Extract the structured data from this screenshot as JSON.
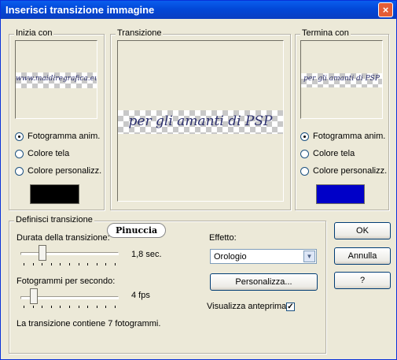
{
  "window": {
    "title": "Inserisci transizione immagine",
    "close": "×"
  },
  "start": {
    "group_label": "Inizia con",
    "preview_text": "www.maidiregrafica.eu",
    "options": [
      "Fotogramma anim.",
      "Colore tela",
      "Colore personalizz."
    ],
    "selected": 0,
    "swatch_color": "#000000"
  },
  "transition": {
    "group_label": "Transizione",
    "preview_text": "per gli amanti di PSP"
  },
  "end": {
    "group_label": "Termina con",
    "preview_text": "per gli amanti di PSP",
    "options": [
      "Fotogramma anim.",
      "Colore tela",
      "Colore personalizz."
    ],
    "selected": 0,
    "swatch_color": "#0000c8"
  },
  "define": {
    "group_label": "Definisci transizione",
    "badge": "Pinuccia",
    "duration_label": "Durata della transizione:",
    "duration_value": "1,8 sec.",
    "fps_label": "Fotogrammi per secondo:",
    "fps_value": "4 fps",
    "summary": "La transizione contiene 7 fotogrammi.",
    "effect_label": "Effetto:",
    "effect_value": "Orologio",
    "customize_button": "Personalizza...",
    "preview_label": "Visualizza anteprima",
    "preview_checked": true,
    "preview_check_glyph": "✓"
  },
  "buttons": {
    "ok": "OK",
    "cancel": "Annulla",
    "help": "?"
  }
}
